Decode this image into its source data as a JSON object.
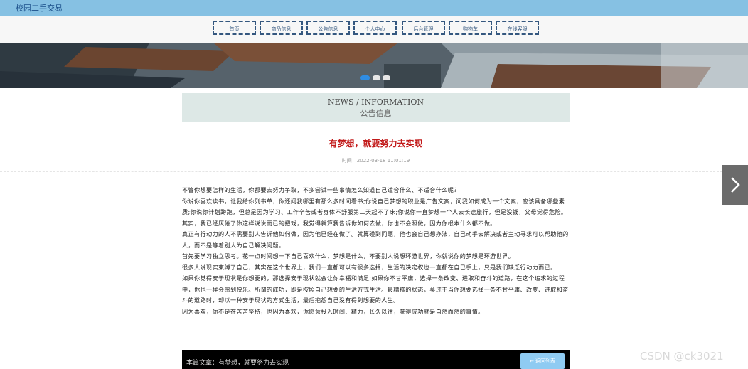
{
  "header": {
    "site_title": "校园二手交易"
  },
  "nav": {
    "items": [
      "首页",
      "商品信息",
      "公告信息",
      "个人中心",
      "后台管理",
      "购物车",
      "在线客服"
    ]
  },
  "banner": {
    "carousel_pages": 3,
    "active_page": 1
  },
  "section": {
    "en": "NEWS / INFORMATION",
    "cn": "公告信息"
  },
  "article": {
    "title": "有梦想，就要努力去实现",
    "time": "时间：2022-03-18 11:01:19",
    "paragraphs": [
      "不管你想要怎样的生活，你都要去努力争取，不多尝试一些事情怎么知道自己适合什么、不适合什么呢？",
      "你说你喜欢读书，让我给你列书单，你还问我哪里有那么多时间看书;你说自己梦想的职业是广告文案，问我如何成为一个文案，应该具备哪些素质;你说你计划蹲跑，但总是因为学习、工作辛苦或者身体不舒服第二天起不了床;你说你一直梦想一个人去长途旅行，但是没钱，父母觉得危险。其实，我已经厌倦了你这样说说而已的把戏，我觉得就算我告诉你如何去做，你也不会照做，因为你根本什么都不做。",
      "真正有行动力的人不需要别人告诉他如何做，因为他已经在做了。就算碰到问题，他也会自己想办法，自己动手去解决或者主动寻求可以帮助他的人，而不是等着别人为自己解决问题。",
      "首先要学习独立思考。花一点时间想一下自己喜欢什么，梦想是什么，不要别人说想环游世界，你就说你的梦想是环游世界。",
      "很多人说现实束缚了自己，其实在这个世界上，我们一直都可以有很多选择，生活的决定权也一直都在自己手上，只是我们缺乏行动力而已。",
      "如果你觉得安于现状是你想要的，那选择安于现状就会让你幸福和满足;如果你不甘平庸，选择一条改变、进取和奋斗的道路，在这个追求的过程中，你也一样会感到快乐。所谓的成功，即是按照自己想要的生活方式生活。最糟糕的状态，莫过于当你想要选择一条不甘平庸、改变、进取和奋斗的道路时，却以一种安于现状的方式生活，最后抱怨自己没有得到想要的人生。",
      "因为喜欢，你不是在苦苦坚持，也因为喜欢，你愿意投入时间、精力，长久以往，获得成功就是自然而然的事情。"
    ]
  },
  "footer": {
    "label": "本篇文章：有梦想，就要努力去实现",
    "return_label": "返回列表"
  },
  "watermark": "CSDN @ck3021",
  "colors": {
    "topbar": "#86c1e3",
    "nav_border": "#34577f",
    "title_red": "#c21a1a",
    "head_bg": "#dde8e6",
    "dot_active": "#2f8de4"
  },
  "icons": {
    "next": "chevron-right-icon",
    "back": "arrow-left-icon"
  }
}
